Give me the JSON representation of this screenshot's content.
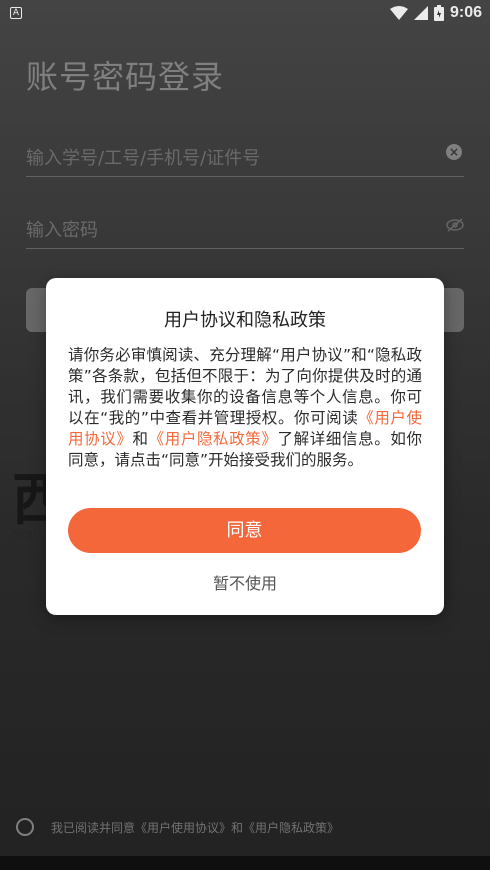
{
  "status_bar": {
    "left_icon_glyph": "A",
    "time": "9:06",
    "icons": [
      "wifi-icon",
      "signal-icon",
      "battery-icon"
    ]
  },
  "login": {
    "title": "账号密码登录",
    "account_placeholder": "输入学号/工号/手机号/证件号",
    "password_placeholder": "输入密码"
  },
  "footer": {
    "agree_text": "我已阅读并同意《用户使用协议》和《用户隐私政策》"
  },
  "dialog": {
    "title": "用户协议和隐私政策",
    "body_part1": "请你务必审慎阅读、充分理解“用户协议”和“隐私政策”各条款，包括但不限于：为了向你提供及时的通讯，我们需要收集你的设备信息等个人信息。你可以在“我的”中查看并管理授权。你可阅读",
    "link_terms": "《用户使用协议》",
    "body_and": "和",
    "link_privacy": "《用户隐私政策》",
    "body_part2": "了解详细信息。如你同意，请点击“同意”开始接受我们的服务。",
    "agree_label": "同意",
    "decline_label": "暂不使用"
  },
  "colors": {
    "accent": "#f3673b",
    "link": "#f36a3c"
  }
}
